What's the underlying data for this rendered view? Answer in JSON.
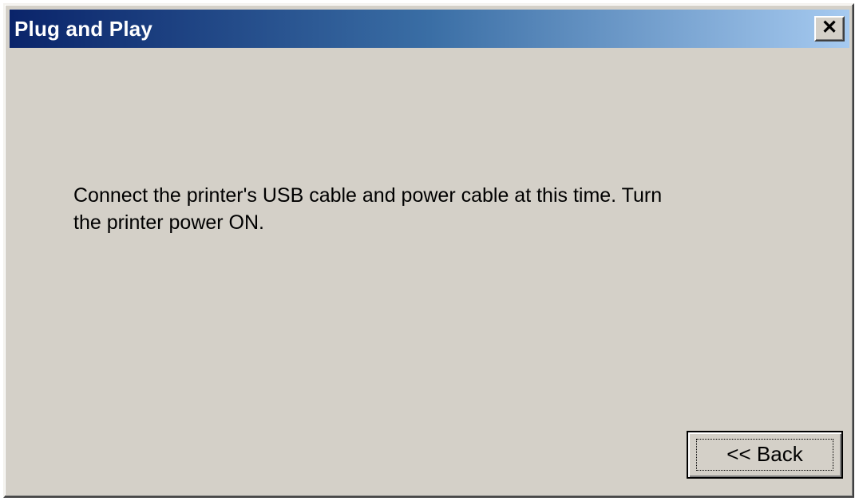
{
  "window": {
    "title": "Plug and Play",
    "close_glyph": "✕"
  },
  "message": {
    "line1": "Connect the printer's USB cable and power cable at this time.  Turn",
    "line2": "the printer power ON."
  },
  "buttons": {
    "back_label": "<< Back"
  },
  "colors": {
    "titlebar_start": "#0a246a",
    "titlebar_end": "#a6caf0",
    "face": "#d4d0c8"
  }
}
